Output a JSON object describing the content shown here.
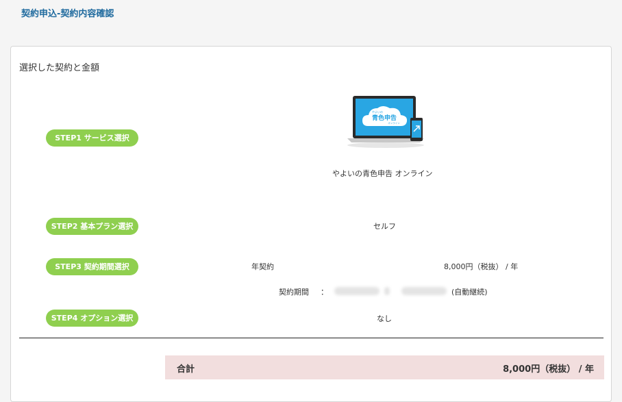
{
  "header": {
    "title": "契約申込-契約内容確認"
  },
  "selection": {
    "heading": "選択した契約と金額",
    "steps": [
      {
        "label": "STEP1 サービス選択",
        "value": "やよいの青色申告 オンライン"
      },
      {
        "label": "STEP2 基本プラン選択",
        "value": "セルフ"
      },
      {
        "label": "STEP3 契約期間選択",
        "value": "年契約",
        "price": "8,000円（税抜） / 年"
      },
      {
        "label": "STEP4 オプション選択",
        "value": "なし"
      }
    ],
    "contract_period": {
      "label": "契約期間",
      "separator": "：",
      "auto_renew": "(自動継続)"
    },
    "product_image": {
      "icon": "laptop-phone-icon",
      "small_text": "やよいの",
      "main_text": "青色申告",
      "sub_text": "オンライン"
    }
  },
  "total": {
    "label": "合計",
    "value": "8,000円（税抜） / 年"
  },
  "colors": {
    "title": "#1f6a9e",
    "step_badge": "#8fcf4f",
    "total_bg": "#f2dede",
    "screen_blue": "#29a6e3"
  }
}
